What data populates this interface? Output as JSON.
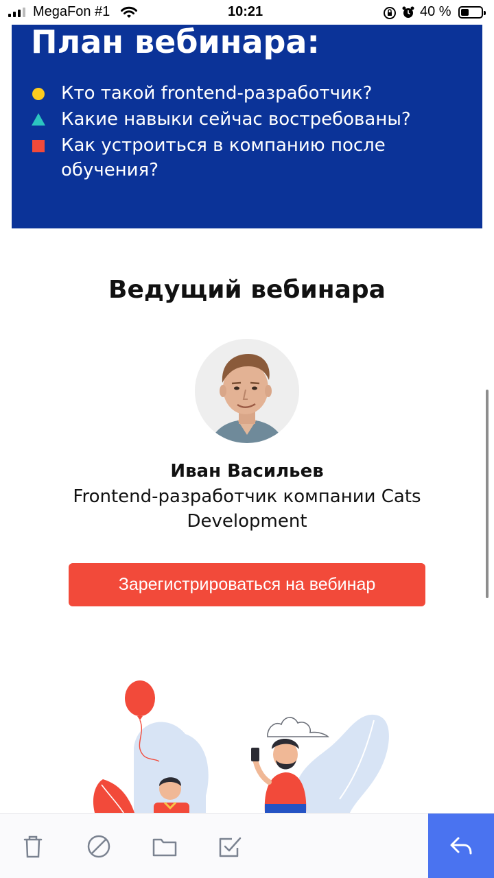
{
  "status_bar": {
    "carrier": "MegaFon #1",
    "time": "10:21",
    "battery": "40 %",
    "battery_level": 0.4,
    "icons": [
      "signal-icon",
      "wifi-icon",
      "orientation-lock-icon",
      "alarm-icon",
      "battery-icon"
    ]
  },
  "plan": {
    "title": "План вебинара:",
    "items": [
      {
        "text": "Кто такой frontend-разработчик?",
        "bullet": "circle",
        "color": "#fccb1e"
      },
      {
        "text": "Какие навыки сейчас востребованы?",
        "bullet": "triangle",
        "color": "#2cc5c0"
      },
      {
        "text": "Как устроиться в компанию после обучения?",
        "bullet": "square",
        "color": "#f24a3a"
      }
    ],
    "background": "#0b3398"
  },
  "host": {
    "heading": "Ведущий вебинара",
    "name": "Иван Васильев",
    "role": "Frontend-разработчик компании Cats Development"
  },
  "cta": {
    "label": "Зарегистрироваться на вебинар",
    "color": "#f24a3a"
  },
  "toolbar": {
    "icons": [
      "trash-icon",
      "block-icon",
      "folder-icon",
      "check-square-icon",
      "reply-icon"
    ],
    "accent": "#4a73f0"
  }
}
